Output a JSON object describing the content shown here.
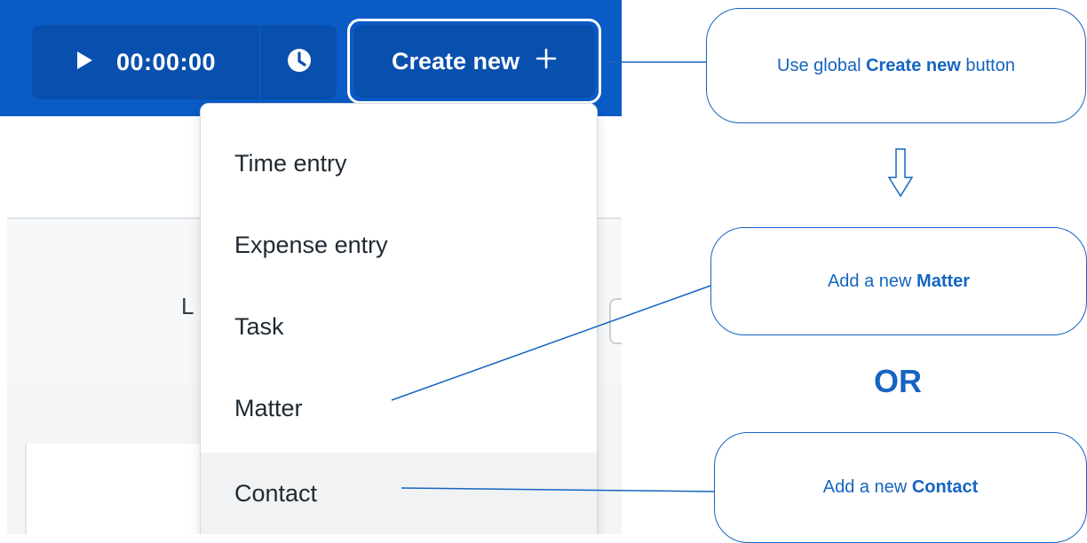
{
  "topbar": {
    "timer_value": "00:00:00",
    "create_label": "Create new",
    "icons": {
      "play": "play-icon",
      "clock": "clock-icon",
      "plus": "plus-icon"
    }
  },
  "background": {
    "partial_letter": "L"
  },
  "dropdown": {
    "items": [
      {
        "label": "Time entry"
      },
      {
        "label": "Expense entry"
      },
      {
        "label": "Task"
      },
      {
        "label": "Matter"
      },
      {
        "label": "Contact"
      }
    ]
  },
  "annotations": {
    "create": {
      "prefix": "Use global ",
      "bold": "Create new",
      "suffix": " button"
    },
    "matter": {
      "prefix": "Add a new ",
      "bold": "Matter"
    },
    "or": "OR",
    "contact": {
      "prefix": "Add a new ",
      "bold": "Contact"
    }
  },
  "colors": {
    "topbar": "#0a5bc6",
    "button_dark": "#084fae",
    "annotation": "#1565c0",
    "highlight_row": "#f1f2f4"
  }
}
